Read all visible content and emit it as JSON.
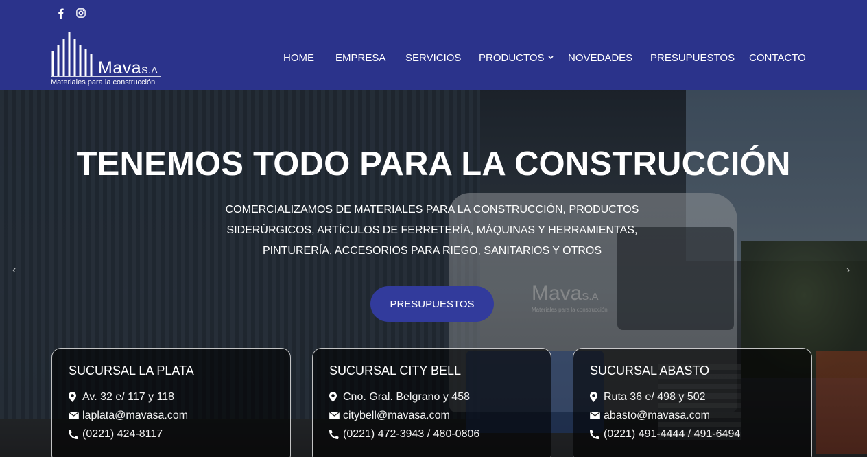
{
  "topbar": {
    "social": [
      {
        "icon": "facebook-icon"
      },
      {
        "icon": "instagram-icon"
      }
    ]
  },
  "header": {
    "logo": {
      "name": "Mava",
      "suffix": "S.A",
      "tagline": "Materiales para la construcción"
    },
    "nav": [
      {
        "label": "HOME"
      },
      {
        "label": "EMPRESA"
      },
      {
        "label": "SERVICIOS"
      },
      {
        "label": "PRODUCTOS",
        "has_dropdown": true
      },
      {
        "label": "NOVEDADES"
      },
      {
        "label": "PRESUPUESTOS"
      },
      {
        "label": "CONTACTO"
      }
    ]
  },
  "hero": {
    "title": "TENEMOS TODO PARA LA CONSTRUCCIÓN",
    "subtitle_lines": [
      "COMERCIALIZAMOS DE MATERIALES PARA LA CONSTRUCCIÓN, PRODUCTOS",
      "SIDERÚRGICOS, ARTÍCULOS DE FERRETERÍA, MÁQUINAS Y HERRAMIENTAS,",
      "PINTURERÍA, ACCESORIOS PARA RIEGO, SANITARIOS Y OTROS"
    ],
    "button_label": "PRESUPUESTOS",
    "prev_arrow": "‹",
    "next_arrow": "›",
    "truck_logo": {
      "name": "Mava",
      "suffix": "S.A",
      "tagline": "Materiales para la construcción"
    }
  },
  "branches": [
    {
      "title": "SUCURSAL LA PLATA",
      "address": "Av. 32 e/ 117 y 118",
      "email": "laplata@mavasa.com",
      "phone": "(0221) 424-8117"
    },
    {
      "title": "SUCURSAL CITY BELL",
      "address": "Cno. Gral. Belgrano y 458",
      "email": "citybell@mavasa.com",
      "phone": "(0221) 472-3943 / 480-0806"
    },
    {
      "title": "SUCURSAL ABASTO",
      "address": "Ruta 36 e/ 498 y 502",
      "email": "abasto@mavasa.com",
      "phone": "(0221) 491-4444 / 491-6494"
    }
  ],
  "colors": {
    "primary": "#2b338b",
    "button": "#323b9c"
  }
}
